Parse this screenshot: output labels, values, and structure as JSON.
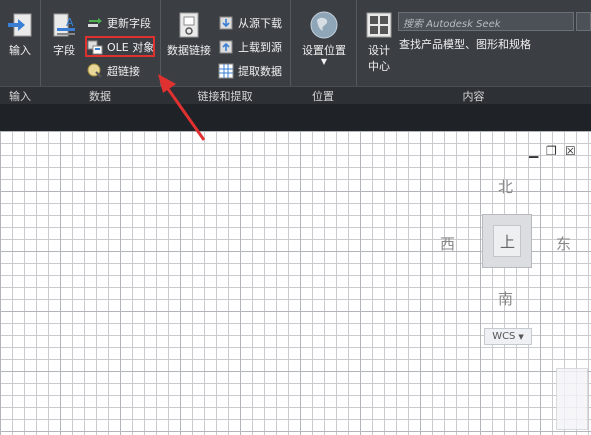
{
  "ribbon": {
    "import_label": "输入",
    "field_label": "字段",
    "update_fields_label": "更新字段",
    "ole_object_label": "OLE 对象",
    "hyperlink_label": "超链接",
    "data_link_label": "数据链接",
    "download_source_label": "从源下载",
    "upload_source_label": "上载到源",
    "extract_data_label": "提取数据",
    "set_location_label": "设置位置",
    "design_center_line1": "设计",
    "design_center_line2": "中心",
    "search_placeholder": "搜索 Autodesk Seek",
    "content_desc": "查找产品模型、图形和规格"
  },
  "panels": {
    "import": "输入",
    "data": "数据",
    "linking": "链接和提取",
    "location": "位置",
    "content": "内容"
  },
  "viewcube": {
    "north": "北",
    "south": "南",
    "east": "东",
    "west": "西",
    "face": "上",
    "wcs": "WCS"
  },
  "colors": {
    "ribbon_bg": "#3b3f44",
    "highlight": "#e03131"
  }
}
